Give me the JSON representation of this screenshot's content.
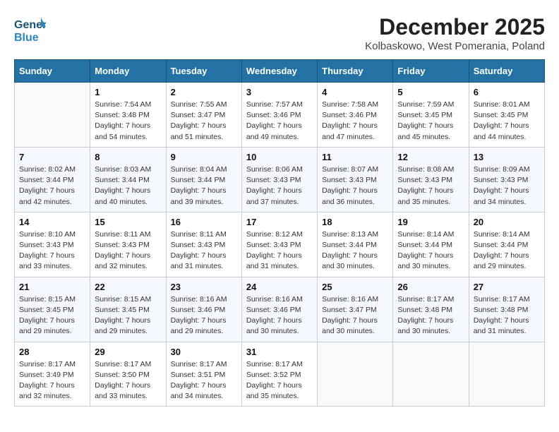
{
  "logo": {
    "line1": "General",
    "line2": "Blue"
  },
  "title": "December 2025",
  "location": "Kolbaskowo, West Pomerania, Poland",
  "weekdays": [
    "Sunday",
    "Monday",
    "Tuesday",
    "Wednesday",
    "Thursday",
    "Friday",
    "Saturday"
  ],
  "weeks": [
    [
      {
        "day": "",
        "sunrise": "",
        "sunset": "",
        "daylight": ""
      },
      {
        "day": "1",
        "sunrise": "7:54 AM",
        "sunset": "3:48 PM",
        "daylight": "7 hours and 54 minutes."
      },
      {
        "day": "2",
        "sunrise": "7:55 AM",
        "sunset": "3:47 PM",
        "daylight": "7 hours and 51 minutes."
      },
      {
        "day": "3",
        "sunrise": "7:57 AM",
        "sunset": "3:46 PM",
        "daylight": "7 hours and 49 minutes."
      },
      {
        "day": "4",
        "sunrise": "7:58 AM",
        "sunset": "3:46 PM",
        "daylight": "7 hours and 47 minutes."
      },
      {
        "day": "5",
        "sunrise": "7:59 AM",
        "sunset": "3:45 PM",
        "daylight": "7 hours and 45 minutes."
      },
      {
        "day": "6",
        "sunrise": "8:01 AM",
        "sunset": "3:45 PM",
        "daylight": "7 hours and 44 minutes."
      }
    ],
    [
      {
        "day": "7",
        "sunrise": "8:02 AM",
        "sunset": "3:44 PM",
        "daylight": "7 hours and 42 minutes."
      },
      {
        "day": "8",
        "sunrise": "8:03 AM",
        "sunset": "3:44 PM",
        "daylight": "7 hours and 40 minutes."
      },
      {
        "day": "9",
        "sunrise": "8:04 AM",
        "sunset": "3:44 PM",
        "daylight": "7 hours and 39 minutes."
      },
      {
        "day": "10",
        "sunrise": "8:06 AM",
        "sunset": "3:43 PM",
        "daylight": "7 hours and 37 minutes."
      },
      {
        "day": "11",
        "sunrise": "8:07 AM",
        "sunset": "3:43 PM",
        "daylight": "7 hours and 36 minutes."
      },
      {
        "day": "12",
        "sunrise": "8:08 AM",
        "sunset": "3:43 PM",
        "daylight": "7 hours and 35 minutes."
      },
      {
        "day": "13",
        "sunrise": "8:09 AM",
        "sunset": "3:43 PM",
        "daylight": "7 hours and 34 minutes."
      }
    ],
    [
      {
        "day": "14",
        "sunrise": "8:10 AM",
        "sunset": "3:43 PM",
        "daylight": "7 hours and 33 minutes."
      },
      {
        "day": "15",
        "sunrise": "8:11 AM",
        "sunset": "3:43 PM",
        "daylight": "7 hours and 32 minutes."
      },
      {
        "day": "16",
        "sunrise": "8:11 AM",
        "sunset": "3:43 PM",
        "daylight": "7 hours and 31 minutes."
      },
      {
        "day": "17",
        "sunrise": "8:12 AM",
        "sunset": "3:43 PM",
        "daylight": "7 hours and 31 minutes."
      },
      {
        "day": "18",
        "sunrise": "8:13 AM",
        "sunset": "3:44 PM",
        "daylight": "7 hours and 30 minutes."
      },
      {
        "day": "19",
        "sunrise": "8:14 AM",
        "sunset": "3:44 PM",
        "daylight": "7 hours and 30 minutes."
      },
      {
        "day": "20",
        "sunrise": "8:14 AM",
        "sunset": "3:44 PM",
        "daylight": "7 hours and 29 minutes."
      }
    ],
    [
      {
        "day": "21",
        "sunrise": "8:15 AM",
        "sunset": "3:45 PM",
        "daylight": "7 hours and 29 minutes."
      },
      {
        "day": "22",
        "sunrise": "8:15 AM",
        "sunset": "3:45 PM",
        "daylight": "7 hours and 29 minutes."
      },
      {
        "day": "23",
        "sunrise": "8:16 AM",
        "sunset": "3:46 PM",
        "daylight": "7 hours and 29 minutes."
      },
      {
        "day": "24",
        "sunrise": "8:16 AM",
        "sunset": "3:46 PM",
        "daylight": "7 hours and 30 minutes."
      },
      {
        "day": "25",
        "sunrise": "8:16 AM",
        "sunset": "3:47 PM",
        "daylight": "7 hours and 30 minutes."
      },
      {
        "day": "26",
        "sunrise": "8:17 AM",
        "sunset": "3:48 PM",
        "daylight": "7 hours and 30 minutes."
      },
      {
        "day": "27",
        "sunrise": "8:17 AM",
        "sunset": "3:48 PM",
        "daylight": "7 hours and 31 minutes."
      }
    ],
    [
      {
        "day": "28",
        "sunrise": "8:17 AM",
        "sunset": "3:49 PM",
        "daylight": "7 hours and 32 minutes."
      },
      {
        "day": "29",
        "sunrise": "8:17 AM",
        "sunset": "3:50 PM",
        "daylight": "7 hours and 33 minutes."
      },
      {
        "day": "30",
        "sunrise": "8:17 AM",
        "sunset": "3:51 PM",
        "daylight": "7 hours and 34 minutes."
      },
      {
        "day": "31",
        "sunrise": "8:17 AM",
        "sunset": "3:52 PM",
        "daylight": "7 hours and 35 minutes."
      },
      {
        "day": "",
        "sunrise": "",
        "sunset": "",
        "daylight": ""
      },
      {
        "day": "",
        "sunrise": "",
        "sunset": "",
        "daylight": ""
      },
      {
        "day": "",
        "sunrise": "",
        "sunset": "",
        "daylight": ""
      }
    ]
  ],
  "labels": {
    "sunrise_prefix": "Sunrise: ",
    "sunset_prefix": "Sunset: ",
    "daylight_prefix": "Daylight: "
  }
}
